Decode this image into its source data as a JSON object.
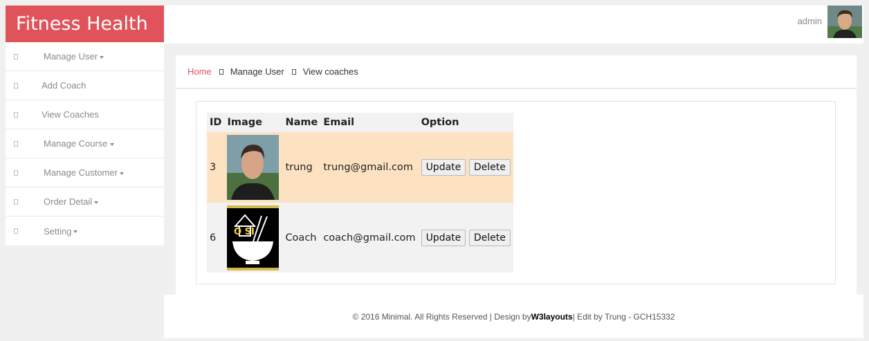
{
  "brand": {
    "title": "Fitness Health"
  },
  "header": {
    "user_name": "admin"
  },
  "sidebar": {
    "items": [
      {
        "label": "Manage User",
        "dropdown": true
      },
      {
        "label": "Add Coach",
        "dropdown": false
      },
      {
        "label": "View Coaches",
        "dropdown": false
      },
      {
        "label": "Manage Course",
        "dropdown": true
      },
      {
        "label": "Manage Customer",
        "dropdown": true
      },
      {
        "label": "Order Detail",
        "dropdown": true
      },
      {
        "label": "Setting",
        "dropdown": true
      }
    ]
  },
  "breadcrumb": {
    "home": "Home",
    "level1": "Manage User",
    "level2": "View coaches"
  },
  "table": {
    "headers": [
      "ID",
      "Image",
      "Name",
      "Email",
      "Option"
    ],
    "rows": [
      {
        "id": "3",
        "image": "photo-of-man",
        "name": "trung",
        "email": "trung@gmail.com",
        "update": "Update",
        "delete": "Delete"
      },
      {
        "id": "6",
        "image": "bowl-logo",
        "logo_text": "O SI",
        "name": "Coach",
        "email": "coach@gmail.com",
        "update": "Update",
        "delete": "Delete"
      }
    ]
  },
  "footer": {
    "prefix": "© 2016 Minimal. All Rights Reserved | Design by ",
    "design_link": "W3layouts",
    "suffix": " | Edit by Trung - GCH15332"
  },
  "colors": {
    "brand": "#e0535a",
    "row_highlight": "#fde2c2",
    "row_alt": "#f2f2f2"
  }
}
